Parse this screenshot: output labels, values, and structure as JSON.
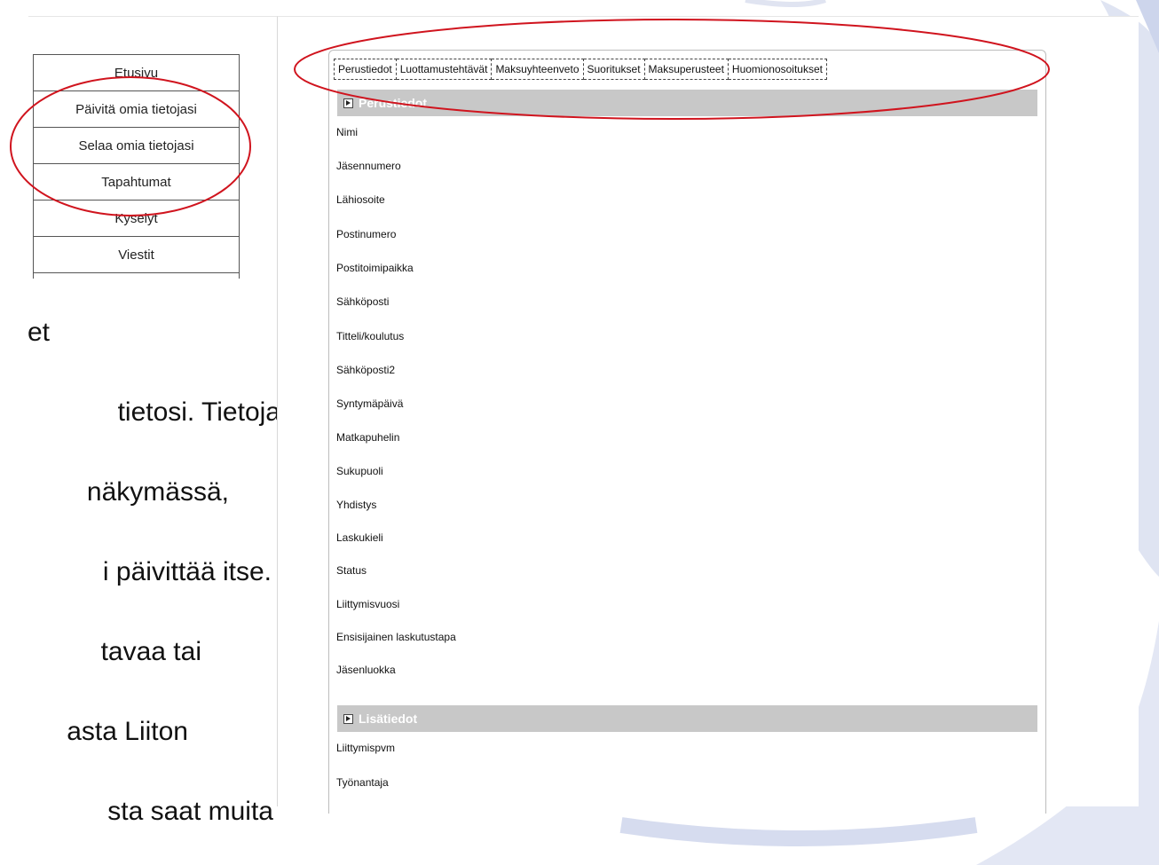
{
  "left_menu": {
    "items": [
      "Etusivu",
      "Päivitä omia tietojasi",
      "Selaa omia tietojasi",
      "Tapahtumat",
      "Kyselyt",
      "Viestit"
    ]
  },
  "slide_text": {
    "lines": [
      "et",
      "tietosi. Tietoja",
      "näkymässä,",
      "i päivittää itse.",
      "tavaa tai",
      "asta Liiton",
      "sta saat muita"
    ]
  },
  "main": {
    "tabs": [
      "Perustiedot",
      "Luottamustehtävät",
      "Maksuyhteenveto",
      "Suoritukset",
      "Maksuperusteet",
      "Huomionosoitukset"
    ],
    "section_basic": {
      "title": "Perustiedot",
      "fields": [
        "Nimi",
        "Jäsennumero",
        "Lähiosoite",
        "Postinumero",
        "Postitoimipaikka",
        "Sähköposti",
        "Titteli/koulutus",
        "Sähköposti2",
        "Syntymäpäivä",
        "Matkapuhelin",
        "Sukupuoli",
        "Yhdistys",
        "Laskukieli",
        "Status",
        "Liittymisvuosi",
        "Ensisijainen laskutustapa",
        "Jäsenluokka"
      ]
    },
    "section_extra": {
      "title": "Lisätiedot",
      "fields": [
        "Liittymispvm",
        "Työnantaja"
      ]
    }
  },
  "colors": {
    "annotation": "#d0141e",
    "section_header": "#c8c8c8",
    "decoration": "#d6dcef"
  }
}
